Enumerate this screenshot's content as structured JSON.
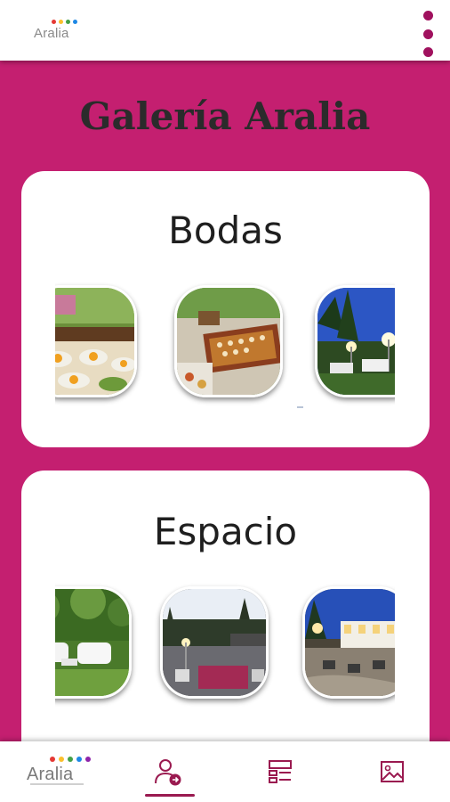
{
  "app": {
    "logo_text": "Aralia",
    "logo_dot_colors": [
      "#e53935",
      "#fbc02d",
      "#43a047",
      "#1e88e5",
      "#8e24aa"
    ],
    "menu_icon": "more-vert-icon"
  },
  "page": {
    "title": "Galería Aralia",
    "background_color": "#c41f70"
  },
  "galleries": [
    {
      "title": "Bodas",
      "images": [
        "buffet-food-photo",
        "catering-tray-photo",
        "night-garden-photo"
      ]
    },
    {
      "title": "Espacio",
      "images": [
        "garden-lounge-photo",
        "dusk-terrace-photo",
        "night-patio-photo"
      ]
    }
  ],
  "bottom_nav": {
    "items": [
      {
        "name": "home",
        "icon": "aralia-logo",
        "label": "Aralia"
      },
      {
        "name": "contact",
        "icon": "user-add-icon",
        "active": true
      },
      {
        "name": "services",
        "icon": "layout-list-icon"
      },
      {
        "name": "gallery",
        "icon": "image-icon"
      }
    ],
    "accent": "#9a1a50"
  }
}
